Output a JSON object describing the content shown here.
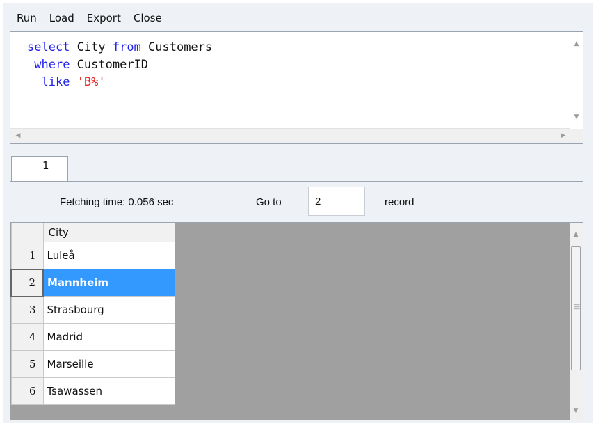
{
  "menu": {
    "items": [
      "Run",
      "Load",
      "Export",
      "Close"
    ]
  },
  "editor": {
    "lines": [
      {
        "indent": "",
        "parts": [
          {
            "text": "select",
            "kind": "keyword"
          },
          {
            "text": " City ",
            "kind": "identifier"
          },
          {
            "text": "from",
            "kind": "keyword"
          },
          {
            "text": " Customers",
            "kind": "identifier"
          }
        ]
      },
      {
        "indent": " ",
        "parts": [
          {
            "text": "where",
            "kind": "keyword"
          },
          {
            "text": " CustomerID",
            "kind": "identifier"
          }
        ]
      },
      {
        "indent": "  ",
        "parts": [
          {
            "text": "like",
            "kind": "keyword"
          },
          {
            "text": " ",
            "kind": "identifier"
          },
          {
            "text": "'B%'",
            "kind": "string"
          }
        ]
      }
    ]
  },
  "tabs": [
    {
      "label": "1",
      "active": true
    }
  ],
  "info": {
    "fetching_time": "Fetching time: 0.056 sec",
    "goto_label": "Go to",
    "goto_value": "2",
    "record_label": "record"
  },
  "results": {
    "columns": [
      "City"
    ],
    "selected_row": 2,
    "rows": [
      {
        "num": "1",
        "city": "Luleå"
      },
      {
        "num": "2",
        "city": "Mannheim"
      },
      {
        "num": "3",
        "city": "Strasbourg"
      },
      {
        "num": "4",
        "city": "Madrid"
      },
      {
        "num": "5",
        "city": "Marseille"
      },
      {
        "num": "6",
        "city": "Tsawassen"
      }
    ]
  },
  "colors": {
    "keyword": "#2323ee",
    "string": "#e02020",
    "selection": "#3399ff",
    "grid_background": "#a0a0a0"
  },
  "icons": {
    "scroll_up": "scroll-up-arrow-icon",
    "scroll_down": "scroll-down-arrow-icon",
    "scroll_left": "scroll-left-arrow-icon",
    "scroll_right": "scroll-right-arrow-icon"
  }
}
